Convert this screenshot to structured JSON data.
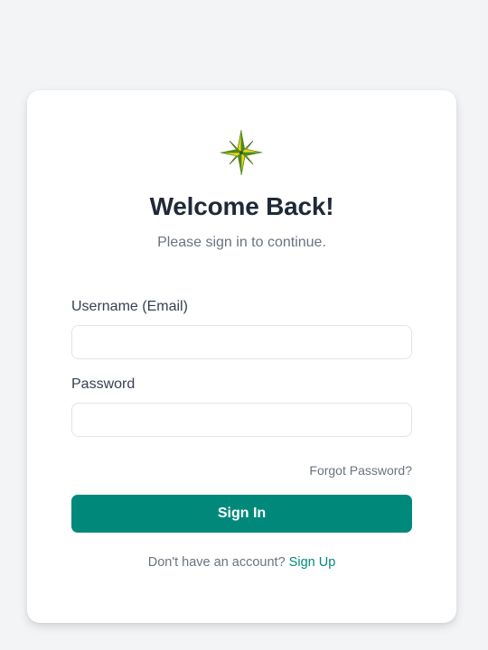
{
  "colors": {
    "page_background": "#f3f4f6",
    "card_background": "#ffffff",
    "accent": "#00897b",
    "heading": "#1f2937",
    "muted_text": "#6b7280",
    "logo_green": "#4b8a1e",
    "logo_yellow": "#f2d21c"
  },
  "logo": {
    "icon": "compass-star-icon"
  },
  "header": {
    "title": "Welcome Back!",
    "subtitle": "Please sign in to continue."
  },
  "form": {
    "username": {
      "label": "Username (Email)",
      "value": "",
      "placeholder": ""
    },
    "password": {
      "label": "Password",
      "value": "",
      "placeholder": ""
    },
    "forgot_link": "Forgot Password?",
    "submit_label": "Sign In"
  },
  "footer": {
    "prompt": "Don't have an account?",
    "signup_link": "Sign Up"
  }
}
